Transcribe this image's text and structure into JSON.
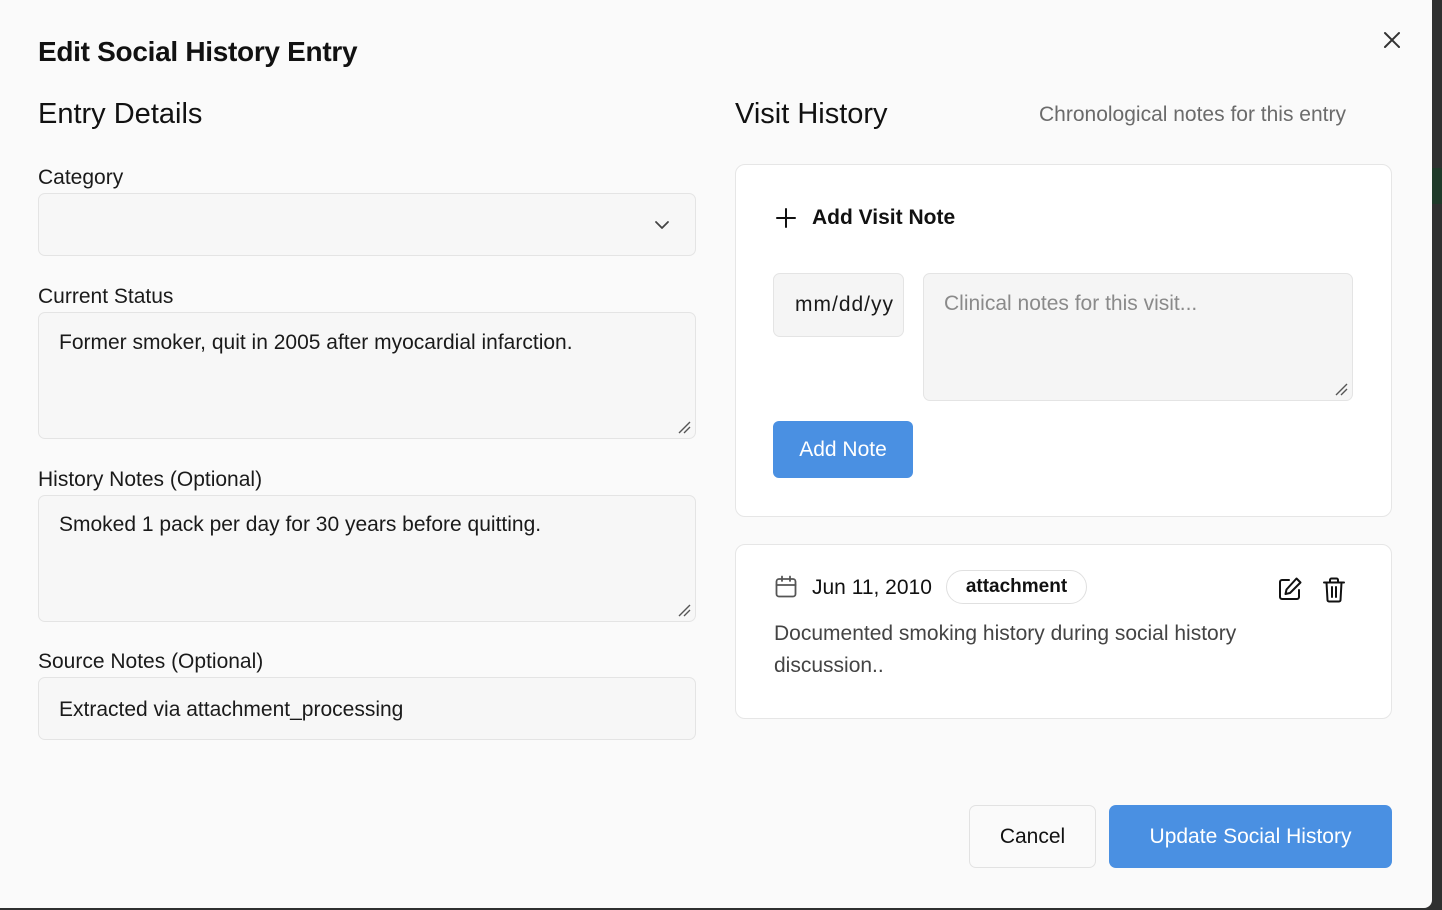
{
  "dialog": {
    "title": "Edit Social History Entry",
    "close_icon": "close-icon"
  },
  "entry_details": {
    "heading": "Entry Details",
    "category": {
      "label": "Category",
      "value": ""
    },
    "current_status": {
      "label": "Current Status",
      "value": "Former smoker, quit in 2005 after myocardial infarction."
    },
    "history_notes": {
      "label": "History Notes (Optional)",
      "value": "Smoked 1 pack per day for 30 years before quitting."
    },
    "source_notes": {
      "label": "Source Notes (Optional)",
      "value": "Extracted via attachment_processing"
    }
  },
  "visit_history": {
    "heading": "Visit History",
    "subtitle": "Chronological notes for this entry",
    "add_form": {
      "title": "Add Visit Note",
      "date_placeholder": "mm/dd/yy",
      "notes_placeholder": "Clinical notes for this visit...",
      "button_label": "Add Note"
    },
    "entries": [
      {
        "date": "Jun 11, 2010",
        "badge": "attachment",
        "text": "Documented smoking history during social history discussion.."
      }
    ]
  },
  "footer": {
    "cancel_label": "Cancel",
    "submit_label": "Update Social History"
  },
  "colors": {
    "primary": "#4a90e2",
    "background": "#fafafa",
    "backdrop": "#2f3030"
  }
}
